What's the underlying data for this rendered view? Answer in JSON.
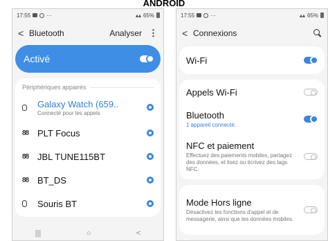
{
  "banner": "ANDROID",
  "left": {
    "status": {
      "time": "17:55",
      "right": "65%"
    },
    "appbar": {
      "title": "Bluetooth",
      "action": "Analyser"
    },
    "master": {
      "label": "Activé"
    },
    "section": "Périphériques appairés",
    "devices": [
      {
        "name": "Galaxy Watch (659..",
        "sub": "Connecté pour les appels",
        "icon": "watch-icon"
      },
      {
        "name": "PLT Focus",
        "icon": "earbuds-icon"
      },
      {
        "name": "JBL TUNE115BT",
        "icon": "earbuds-icon"
      },
      {
        "name": "BT_DS",
        "icon": "earbuds-icon"
      },
      {
        "name": "Souris BT",
        "icon": "mouse-icon"
      }
    ]
  },
  "right": {
    "status": {
      "time": "17:55",
      "right": "65%"
    },
    "appbar": {
      "title": "Connexions"
    },
    "items": [
      {
        "name": "Wi-Fi",
        "toggle": "on"
      },
      {
        "name": "Appels Wi-Fi",
        "toggle": "off"
      },
      {
        "name": "Bluetooth",
        "sub": "1 appareil connecté.",
        "toggle": "on"
      },
      {
        "name": "NFC et paiement",
        "sub": "Effectuez des paiements mobiles, partagez des données, et lisez ou écrivez des tags NFC.",
        "toggle": "off"
      },
      {
        "name": "Mode Hors ligne",
        "sub": "Désactivez les fonctions d'appel et de messagerie, ainsi que les données mobiles.",
        "toggle": "off"
      }
    ]
  },
  "colors": {
    "accent": "#3e8ee6",
    "background": "#f4f4f4"
  }
}
